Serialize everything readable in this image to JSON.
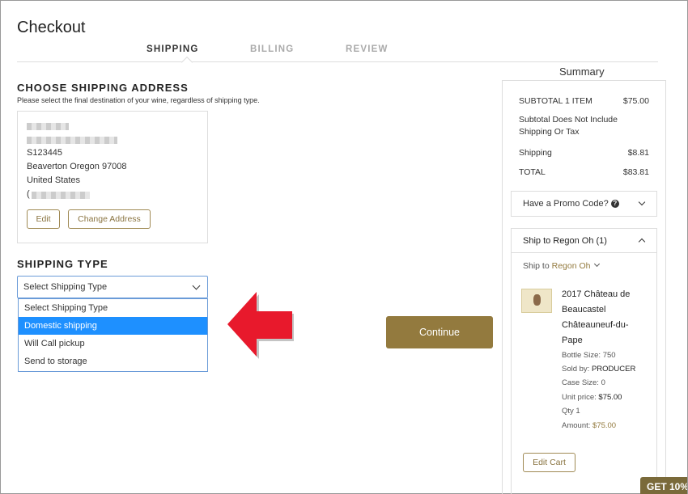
{
  "page": {
    "title": "Checkout"
  },
  "steps": [
    {
      "label": "SHIPPING",
      "active": true
    },
    {
      "label": "BILLING",
      "active": false
    },
    {
      "label": "REVIEW",
      "active": false
    }
  ],
  "address_section": {
    "title": "CHOOSE SHIPPING ADDRESS",
    "subtitle": "Please select the final destination of your wine, regardless of shipping type.",
    "address": {
      "line_code": "S123445",
      "city_line": "Beaverton Oregon 97008",
      "country": "United States",
      "phone_prefix": "("
    },
    "edit_label": "Edit",
    "change_label": "Change Address"
  },
  "shipping_type": {
    "title": "SHIPPING TYPE",
    "selected": "Select Shipping Type",
    "options": [
      "Select Shipping Type",
      "Domestic shipping",
      "Will Call pickup",
      "Send to storage"
    ],
    "highlighted_index": 1
  },
  "continue_label": "Continue",
  "summary": {
    "label": "Summary",
    "subtotal_label": "SUBTOTAL 1 ITEM",
    "subtotal_value": "$75.00",
    "note_line1": "Subtotal Does Not Include",
    "note_line2": "Shipping Or Tax",
    "shipping_label": "Shipping",
    "shipping_value": "$8.81",
    "total_label": "TOTAL",
    "total_value": "$83.81",
    "promo_label": "Have a Promo Code?",
    "ship_header": "Ship to Regon Oh (1)",
    "ship_to_prefix": "Ship to",
    "ship_to_name": "Regon Oh",
    "item": {
      "name_line1": "2017 Château de",
      "name_line2": "Beaucastel",
      "name_line3": "Châteauneuf-du-",
      "name_line4": "Pape",
      "bottle_size": "Bottle Size: 750",
      "sold_by_label": "Sold by:",
      "sold_by_value": "PRODUCER",
      "case_size": "Case Size: 0",
      "unit_price_label": "Unit price:",
      "unit_price_value": "$75.00",
      "qty": "Qty 1",
      "amount_label": "Amount:",
      "amount_value": "$75.00"
    },
    "edit_cart_label": "Edit Cart"
  },
  "promo_tab": {
    "label": "GET 10%"
  },
  "colors": {
    "accent": "#937a3e",
    "select_highlight": "#1e90ff",
    "arrow": "#e8192c"
  }
}
